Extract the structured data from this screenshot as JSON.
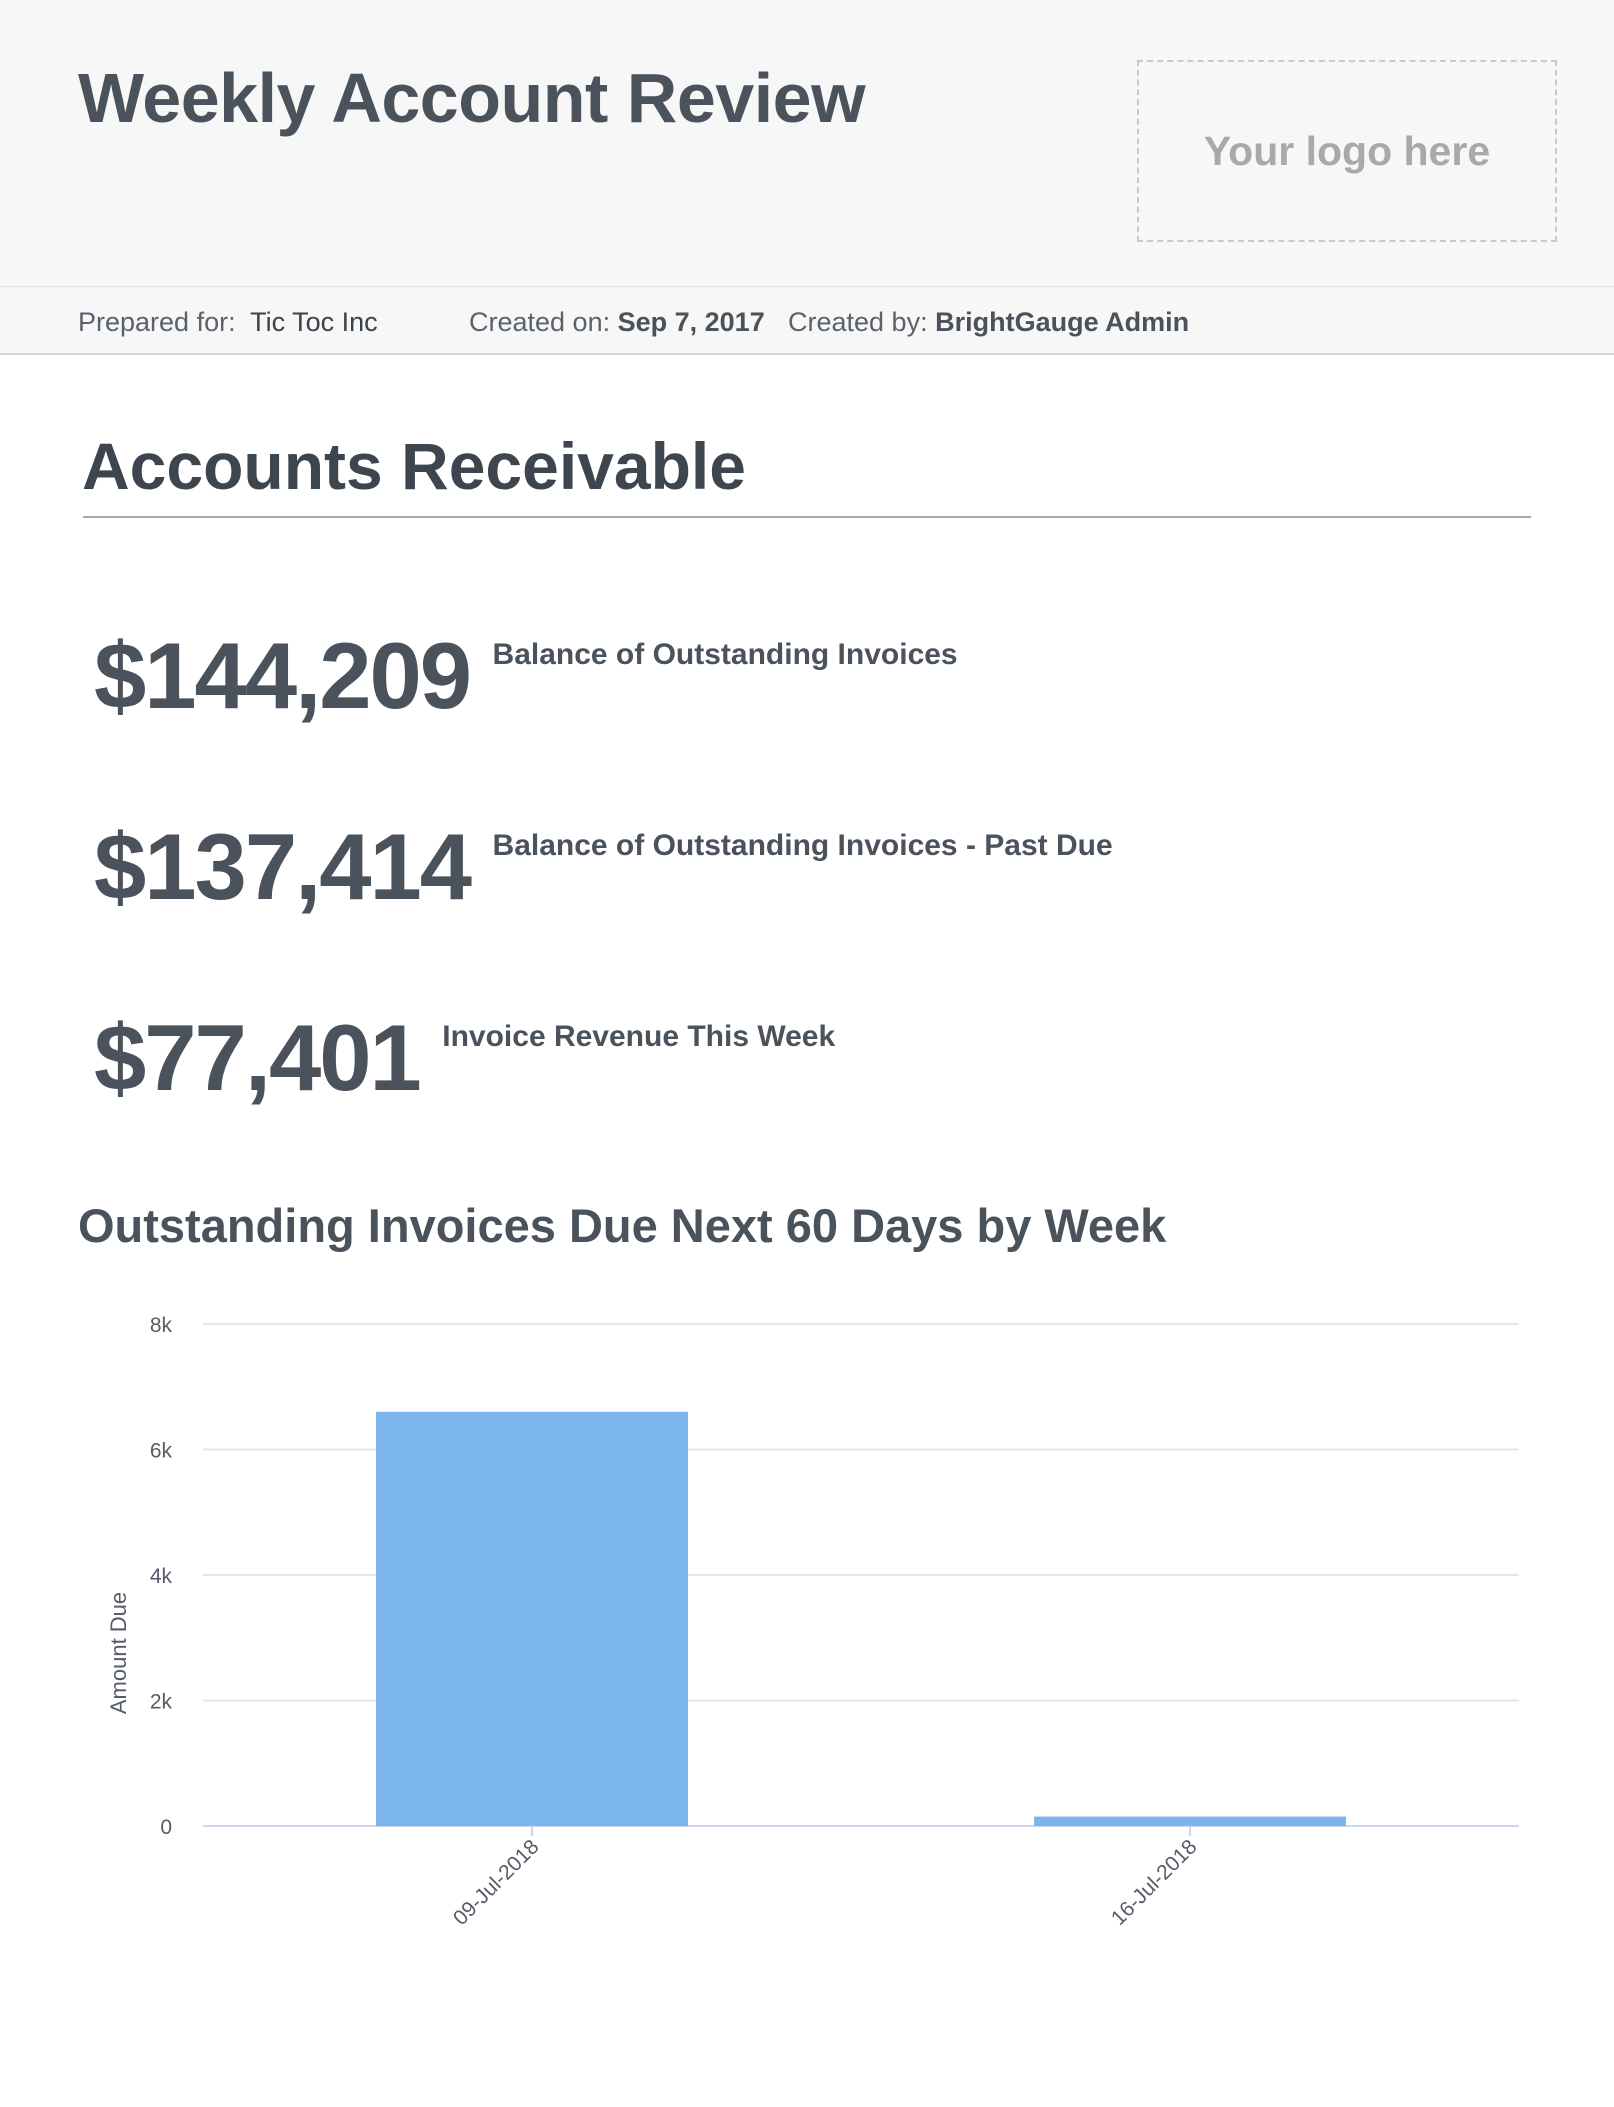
{
  "header": {
    "title": "Weekly Account Review",
    "logo_placeholder": "Your logo here"
  },
  "meta": {
    "prepared_for_label": "Prepared for:",
    "prepared_for_value": "Tic Toc Inc",
    "created_on_label": "Created on:",
    "created_on_value": "Sep 7, 2017",
    "created_by_label": "Created by:",
    "created_by_value": "BrightGauge Admin"
  },
  "section": {
    "title": "Accounts Receivable"
  },
  "kpis": [
    {
      "value": "$144,209",
      "label": "Balance of Outstanding Invoices"
    },
    {
      "value": "$137,414",
      "label": "Balance of Outstanding Invoices - Past Due"
    },
    {
      "value": "$77,401",
      "label": "Invoice Revenue This Week"
    }
  ],
  "chart_data": {
    "type": "bar",
    "title": "Outstanding Invoices Due Next 60 Days by Week",
    "xlabel": "",
    "ylabel": "Amount Due",
    "categories": [
      "09-Jul-2018",
      "16-Jul-2018"
    ],
    "values": [
      6600,
      150
    ],
    "ylim": [
      0,
      8000
    ],
    "yticks": [
      0,
      2000,
      4000,
      6000,
      8000
    ],
    "ytick_labels": [
      "0",
      "2k",
      "4k",
      "6k",
      "8k"
    ],
    "grid": true,
    "bar_color": "#7cb5ec",
    "legend": "none"
  }
}
